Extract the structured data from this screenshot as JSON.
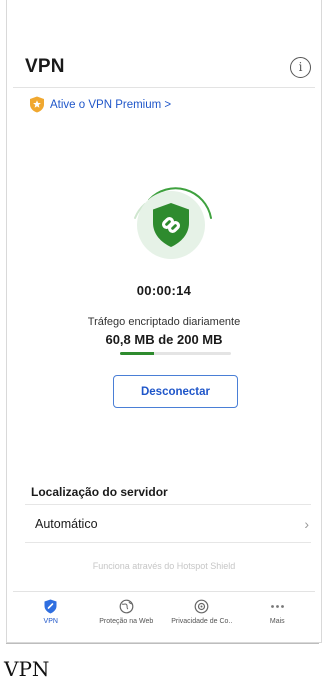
{
  "header": {
    "title": "VPN",
    "info_icon": "info-icon"
  },
  "premium": {
    "label": "Ative o VPN Premium >",
    "badge_icon": "star-badge-icon",
    "badge_color": "#f0a830"
  },
  "status": {
    "timer": "00:00:14",
    "traffic_label": "Tráfego encriptado diariamente",
    "traffic_value": "60,8 MB de 200 MB",
    "traffic_fraction": 0.304,
    "shield_icon": "shield-link-icon",
    "shield_color": "#2e8b2e"
  },
  "actions": {
    "disconnect": "Desconectar"
  },
  "server": {
    "section_title": "Localização do servidor",
    "value": "Automático",
    "chevron_icon": "chevron-right-icon"
  },
  "powered_by": "Funciona através do Hotspot Shield",
  "tabs": [
    {
      "label": "VPN",
      "icon": "vpn-shield-icon",
      "active": true
    },
    {
      "label": "Proteção na Web",
      "icon": "globe-icon",
      "active": false
    },
    {
      "label": "Privacidade de Co..",
      "icon": "privacy-icon",
      "active": false
    },
    {
      "label": "Mais",
      "icon": "more-dots-icon",
      "active": false
    }
  ],
  "caption": "VPN",
  "colors": {
    "accent": "#1f56c9",
    "success": "#2e8b2e"
  }
}
